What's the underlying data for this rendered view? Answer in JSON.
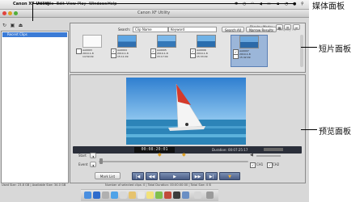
{
  "menubar": {
    "app": "Canon XF Utility",
    "items": [
      "File",
      "Edit",
      "View",
      "Play",
      "Windows",
      "Help"
    ]
  },
  "window": {
    "title": "Canon XF Utility"
  },
  "media_panel": {
    "selected_item": "Recent Clips"
  },
  "clip_panel": {
    "display_mode_label": "Display Mode:",
    "search_label": "Search:",
    "search_field_value": "Clip Name",
    "keyword_placeholder": "Keyword",
    "search_all": "Search All",
    "narrow_results": "Narrow Results",
    "display_all": "Display All",
    "clips": [
      {
        "name": "AA0003",
        "date": "2010-1-8",
        "time": "14:59:09",
        "checked": false,
        "selected": false
      },
      {
        "name": "AA0004",
        "date": "2010-1-8",
        "time": "15:11:09",
        "checked": true,
        "selected": false
      },
      {
        "name": "AA0005",
        "date": "2010-1-8",
        "time": "15:17:09",
        "checked": true,
        "selected": false
      },
      {
        "name": "AA0006",
        "date": "2010-1-8",
        "time": "15:33:09",
        "checked": true,
        "selected": false
      },
      {
        "name": "AA0007",
        "date": "2010-1-8",
        "time": "15:42:09",
        "checked": true,
        "selected": true
      }
    ]
  },
  "preview_panel": {
    "timecode": "00:08:20:01",
    "duration_label": "Duration: 00:07:25:17",
    "mark_list": "Mark List",
    "in_label": "Start",
    "out_label": "Event",
    "ch1": "CH1",
    "ch2": "CH2",
    "play_icons": [
      "|◀",
      "◀◀",
      "▶",
      "▶▶",
      "▶|",
      "▼"
    ]
  },
  "status": {
    "left": "Used Size: 23.8 GB | Available Size: 34.0 GB",
    "right": "Number of selected clips: 0 | Total Duration: 00:00:00:00 | Total Size: 0 B"
  },
  "callouts": {
    "media": "媒体面板",
    "clip": "短片面板",
    "preview": "预览面板"
  }
}
